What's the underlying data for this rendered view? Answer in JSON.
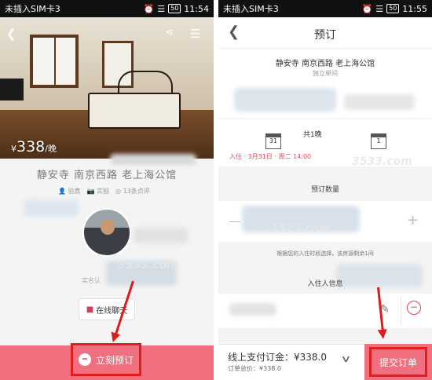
{
  "left_screen": {
    "status": {
      "carrier": "未插入SIM卡3",
      "time": "11:54",
      "battery": "50"
    },
    "header": {
      "back_icon": "chevron-left-icon",
      "share_icon": "share-icon",
      "menu_icon": "menu-icon"
    },
    "listing": {
      "price_symbol": "¥",
      "price_value": "338",
      "price_unit": "/晚",
      "title": "静安寺 南京西路 老上海公馆",
      "meta": [
        "验真",
        "实拍",
        "13条点评"
      ]
    },
    "host": {
      "verified_text": "实名认"
    },
    "chat_button_label": "在线聊天",
    "book_button_label": "立刻预订"
  },
  "right_screen": {
    "status": {
      "carrier": "未插入SIM卡3",
      "time": "11:55",
      "battery": "50"
    },
    "header": {
      "title": "预订",
      "back_icon": "chevron-left-icon"
    },
    "hotel": {
      "name": "静安寺 南京西路 老上海公馆",
      "room_type": "独立单间"
    },
    "dates": {
      "checkin_day": "31",
      "checkout_day": "1",
      "nights": "共1晚",
      "checkin_text": "入住 · 3月31日 · 周二 14:00"
    },
    "quantity_label": "预订数量",
    "availability_hint": "根据您的入住时段选择，该房源剩余1间",
    "guest_section_label": "入住人信息",
    "payment": {
      "online_label": "线上支付订金：¥338.0",
      "total_label": "订单总价：¥338.0",
      "submit_label": "提交订单"
    }
  },
  "watermark": "3533.com",
  "colors": {
    "accent": "#f0707f",
    "highlight_red": "#e01919",
    "checkin_red": "#e8425c"
  }
}
